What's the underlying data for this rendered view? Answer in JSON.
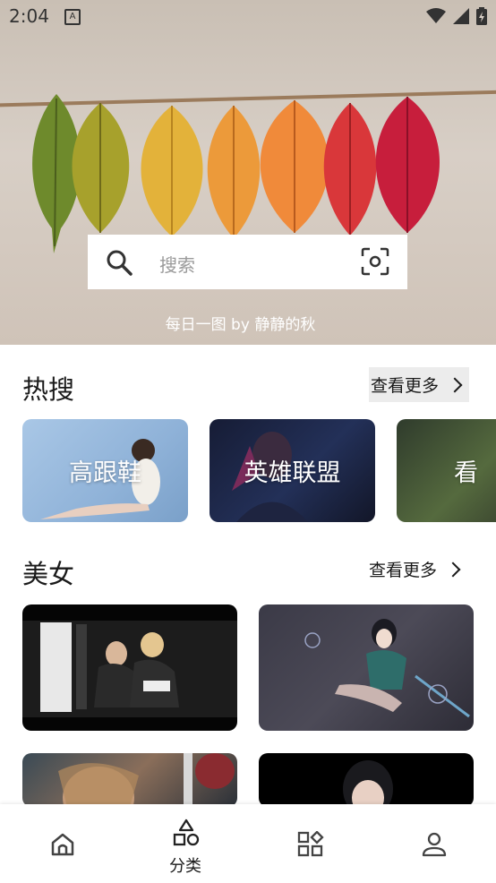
{
  "status_bar": {
    "time": "2:04",
    "notif_letter": "A"
  },
  "hero": {
    "search_placeholder": "搜索",
    "caption": "每日一图 by 静静的秋"
  },
  "hot": {
    "title": "热搜",
    "more_label": "查看更多",
    "cards": [
      {
        "label": "高跟鞋"
      },
      {
        "label": "英雄联盟"
      },
      {
        "label": "看"
      }
    ]
  },
  "beauty": {
    "title": "美女",
    "more_label": "查看更多"
  },
  "nav": {
    "items": [
      {
        "icon": "home-icon",
        "label": ""
      },
      {
        "icon": "category-icon",
        "label": "分类"
      },
      {
        "icon": "apps-icon",
        "label": ""
      },
      {
        "icon": "profile-icon",
        "label": ""
      }
    ],
    "active_index": 1
  },
  "colors": {
    "text_primary": "#1a1a1a",
    "placeholder": "#9a9a9a",
    "more_bg": "#ececec"
  }
}
